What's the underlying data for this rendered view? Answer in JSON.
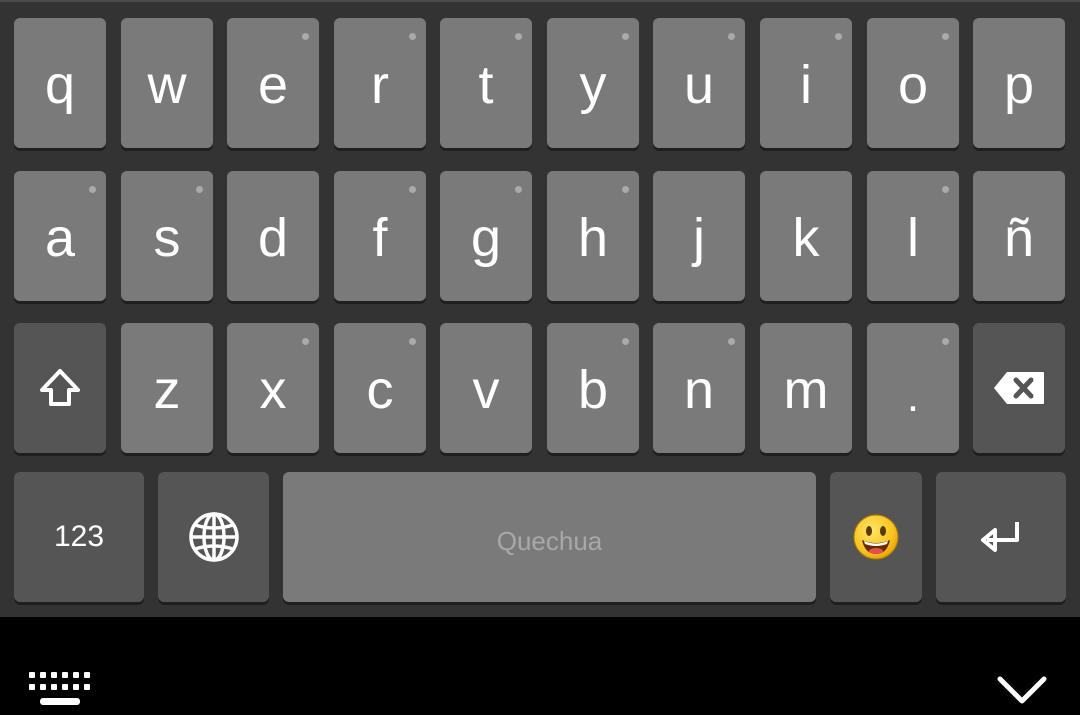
{
  "keyboard": {
    "row1": [
      "q",
      "w",
      "e",
      "r",
      "t",
      "y",
      "u",
      "i",
      "o",
      "p"
    ],
    "row1_dots": [
      false,
      false,
      true,
      true,
      true,
      true,
      true,
      true,
      true,
      false
    ],
    "row2": [
      "a",
      "s",
      "d",
      "f",
      "g",
      "h",
      "j",
      "k",
      "l",
      "ñ"
    ],
    "row2_dots": [
      true,
      true,
      false,
      true,
      true,
      true,
      false,
      false,
      true,
      false
    ],
    "row3": [
      "z",
      "x",
      "c",
      "v",
      "b",
      "n",
      "m",
      "."
    ],
    "row3_dots": [
      false,
      true,
      true,
      false,
      true,
      true,
      false,
      true
    ],
    "symbols_label": "123",
    "space_label": "Quechua",
    "shift_icon": "shift-arrow-icon",
    "backspace_icon": "backspace-icon",
    "globe_icon": "globe-icon",
    "emoji_icon": "emoji-icon",
    "enter_icon": "enter-return-icon"
  },
  "navbar": {
    "left_icon": "keyboard-switch-icon",
    "right_icon": "chevron-down-icon"
  },
  "colors": {
    "keyboard_bg": "#333333",
    "letter_key": "#7a7a7a",
    "function_key": "#555555",
    "key_text": "#ffffff",
    "navbar_bg": "#000000"
  }
}
